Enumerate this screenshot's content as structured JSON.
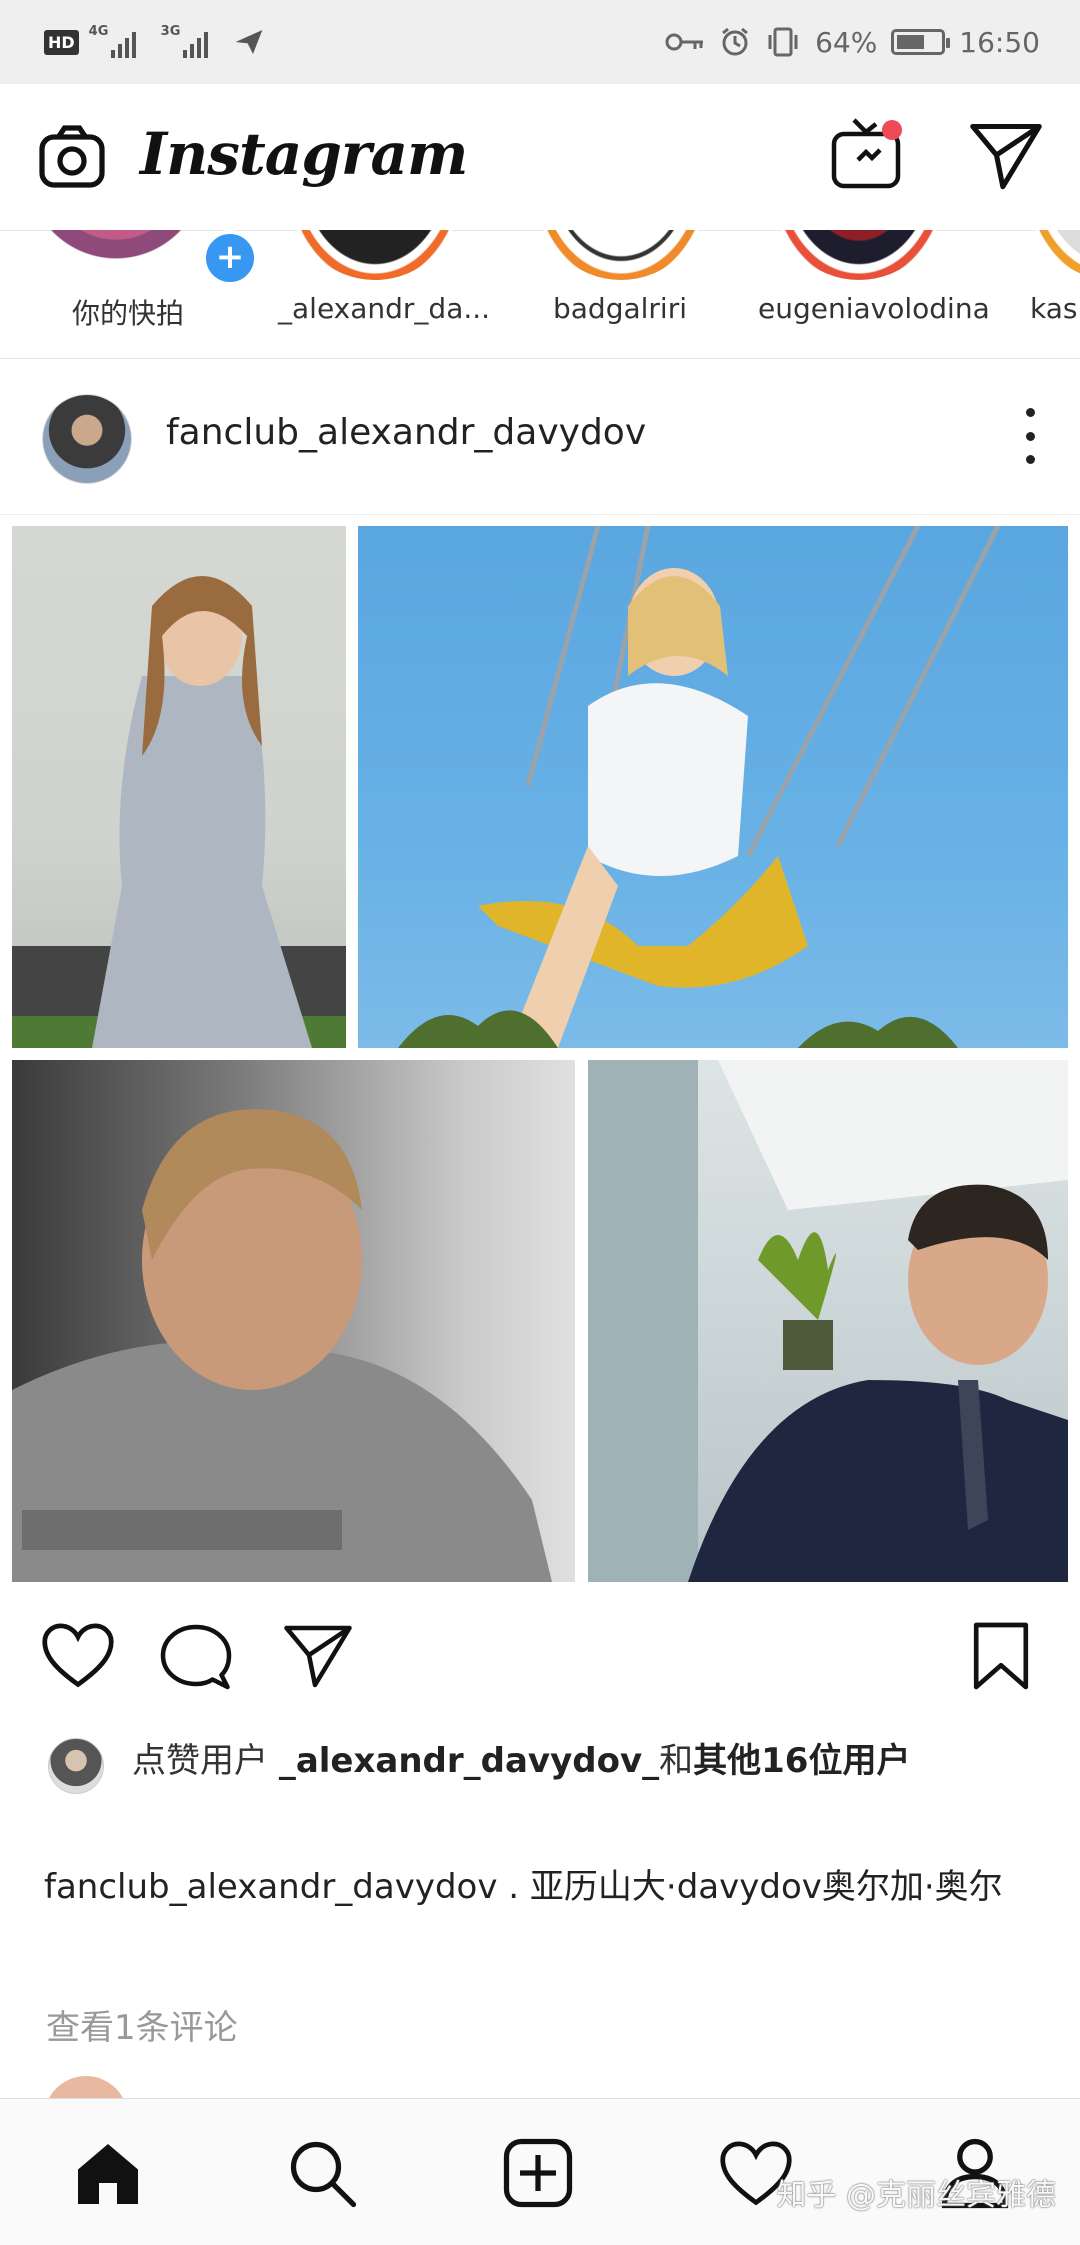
{
  "status_bar": {
    "hd": "HD",
    "net1": "4G",
    "net2": "3G",
    "battery_pct": "64%",
    "battery_level": 0.64,
    "time": "16:50"
  },
  "header": {
    "logo": "Instagram",
    "igtv_has_notification": true,
    "accent_color": "#ed4956"
  },
  "stories": [
    {
      "label": "你的快拍"
    },
    {
      "label": "_alexandr_da..."
    },
    {
      "label": "badgalriri"
    },
    {
      "label": "eugeniavolodina"
    },
    {
      "label": "kas"
    }
  ],
  "post": {
    "username": "fanclub_alexandr_davydov",
    "likes_prefix": "点赞用户 ",
    "likes_user": "_alexandr_davydov_",
    "likes_suffix": "和",
    "likes_others": "其他16位用户",
    "caption_user": "fanclub_alexandr_davydov",
    "caption_text": ". 亚历山大·davydov奥尔加·奥尔",
    "view_comments": "查看1条评论"
  },
  "watermark": "知乎 @克丽丝宾雅德",
  "icons": [
    "camera-icon",
    "igtv-icon",
    "direct-icon",
    "heart-icon",
    "comment-icon",
    "share-icon",
    "bookmark-icon",
    "home-icon",
    "search-icon",
    "add-icon",
    "activity-icon",
    "profile-icon"
  ]
}
